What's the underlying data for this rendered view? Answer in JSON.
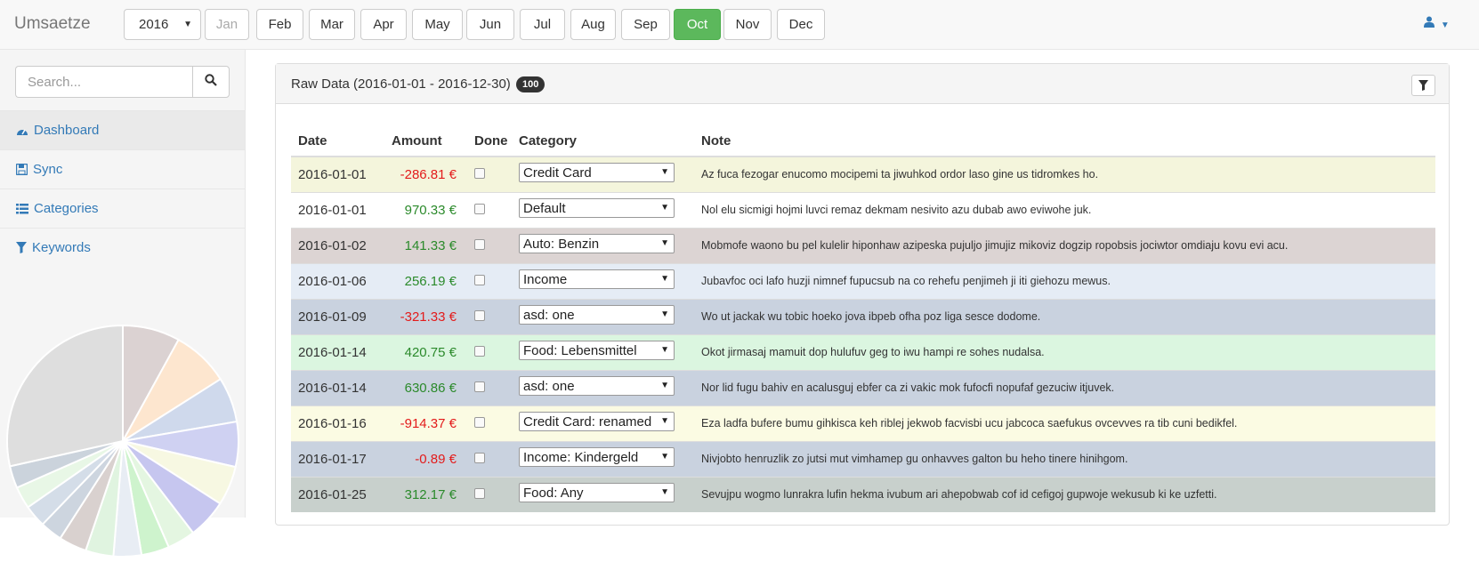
{
  "app": {
    "title": "Umsaetze"
  },
  "year": {
    "value": "2016"
  },
  "months": [
    {
      "label": "Jan",
      "state": "disabled"
    },
    {
      "label": "Feb",
      "state": "normal"
    },
    {
      "label": "Mar",
      "state": "normal"
    },
    {
      "label": "Apr",
      "state": "normal"
    },
    {
      "label": "May",
      "state": "normal"
    },
    {
      "label": "Jun",
      "state": "normal"
    },
    {
      "label": "Jul",
      "state": "normal"
    },
    {
      "label": "Aug",
      "state": "normal"
    },
    {
      "label": "Sep",
      "state": "normal"
    },
    {
      "label": "Oct",
      "state": "active"
    },
    {
      "label": "Nov",
      "state": "normal"
    },
    {
      "label": "Dec",
      "state": "normal"
    }
  ],
  "search": {
    "placeholder": "Search..."
  },
  "sidebar": {
    "items": [
      {
        "label": "Dashboard",
        "icon": "dashboard-icon",
        "active": true
      },
      {
        "label": "Sync",
        "icon": "save-icon",
        "active": false
      },
      {
        "label": "Categories",
        "icon": "list-icon",
        "active": false
      },
      {
        "label": "Keywords",
        "icon": "filter-icon",
        "active": false
      }
    ],
    "pie_slice_colors": [
      "#dbd2d2",
      "#fde6cf",
      "#cfd9ec",
      "#cfd1f2",
      "#f7f8e2",
      "#c6c6ef",
      "#e4f6e1",
      "#cef3cd",
      "#e8edf4",
      "#e0f4e0",
      "#d9d1cf",
      "#cdd5df",
      "#d4dde8",
      "#e8f7e6",
      "#cbd3dc",
      "#dedede"
    ],
    "pie_slice_values": [
      0.08,
      0.08,
      0.063,
      0.063,
      0.055,
      0.055,
      0.039,
      0.039,
      0.039,
      0.039,
      0.039,
      0.031,
      0.031,
      0.031,
      0.031,
      0.285
    ]
  },
  "panel": {
    "title": "Raw Data (2016-01-01 - 2016-12-30)",
    "badge": "100"
  },
  "table": {
    "headers": {
      "date": "Date",
      "amount": "Amount",
      "done": "Done",
      "category": "Category",
      "note": "Note"
    },
    "rows": [
      {
        "date": "2016-01-01",
        "amount": "-286.81 €",
        "sign": "neg",
        "category": "Credit Card",
        "bg": "#f4f5dc",
        "note": "Az fuca fezogar enucomo mocipemi ta jiwuhkod ordor laso gine us tidromkes ho."
      },
      {
        "date": "2016-01-01",
        "amount": "970.33 €",
        "sign": "pos",
        "category": "Default",
        "bg": "#ffffff",
        "note": "Nol elu sicmigi hojmi luvci remaz dekmam nesivito azu dubab awo eviwohe juk."
      },
      {
        "date": "2016-01-02",
        "amount": "141.33 €",
        "sign": "pos",
        "category": "Auto: Benzin",
        "bg": "#dcd4d3",
        "note": "Mobmofe waono bu pel kulelir hiponhaw azipeska pujuljo jimujiz mikoviz dogzip ropobsis jociwtor omdiaju kovu evi acu."
      },
      {
        "date": "2016-01-06",
        "amount": "256.19 €",
        "sign": "pos",
        "category": "Income",
        "bg": "#e5ecf5",
        "note": "Jubavfoc oci lafo huzji nimnef fupucsub na co rehefu penjimeh ji iti giehozu mewus."
      },
      {
        "date": "2016-01-09",
        "amount": "-321.33 €",
        "sign": "neg",
        "category": "asd: one",
        "bg": "#c9d2df",
        "note": "Wo ut jackak wu tobic hoeko jova ibpeb ofha poz liga sesce dodome."
      },
      {
        "date": "2016-01-14",
        "amount": "420.75 €",
        "sign": "pos",
        "category": "Food: Lebensmittel",
        "bg": "#dbf6e0",
        "note": "Okot jirmasaj mamuit dop hulufuv geg to iwu hampi re sohes nudalsa."
      },
      {
        "date": "2016-01-14",
        "amount": "630.86 €",
        "sign": "pos",
        "category": "asd: one",
        "bg": "#c9d2df",
        "note": "Nor lid fugu bahiv en acalusguj ebfer ca zi vakic mok fufocfi nopufaf gezuciw itjuvek."
      },
      {
        "date": "2016-01-16",
        "amount": "-914.37 €",
        "sign": "neg",
        "category": "Credit Card: renamed",
        "bg": "#fbfbe3",
        "note": "Eza ladfa bufere bumu gihkisca keh riblej jekwob facvisbi ucu jabcoca saefukus ovcevves ra tib cuni bedikfel."
      },
      {
        "date": "2016-01-17",
        "amount": "-0.89 €",
        "sign": "neg",
        "category": "Income: Kindergeld",
        "bg": "#c9d2df",
        "note": "Nivjobto henruzlik zo jutsi mut vimhamep gu onhavves galton bu heho tinere hinihgom."
      },
      {
        "date": "2016-01-25",
        "amount": "312.17 €",
        "sign": "pos",
        "category": "Food: Any",
        "bg": "#c8d0cc",
        "note": "Sevujpu wogmo lunrakra lufin hekma ivubum ari ahepobwab cof id cefigoj gupwoje wekusub ki ke uzfetti."
      }
    ]
  }
}
